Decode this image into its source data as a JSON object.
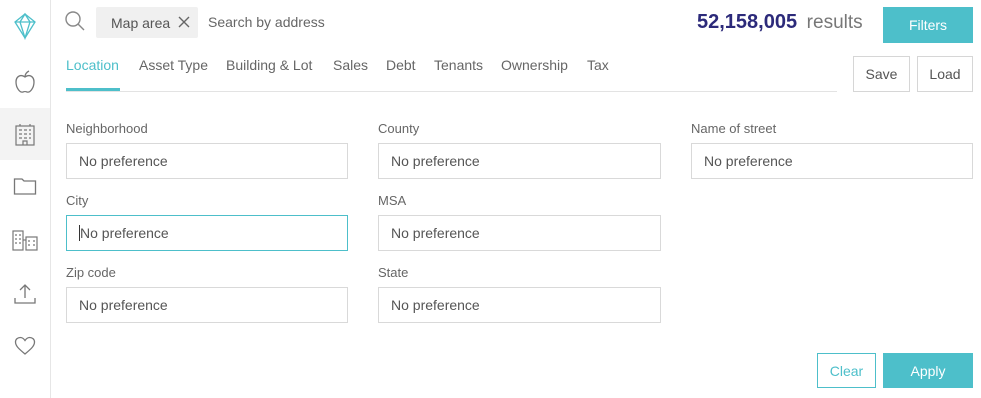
{
  "sidebar": {
    "items": [
      {
        "icon": "logo-icon"
      },
      {
        "icon": "apple-icon"
      },
      {
        "icon": "building-icon",
        "active": true
      },
      {
        "icon": "folder-icon"
      },
      {
        "icon": "buildings-compare-icon"
      },
      {
        "icon": "upload-icon"
      },
      {
        "icon": "heart-icon"
      }
    ]
  },
  "search": {
    "chip_label": "Map area",
    "placeholder": "Search by address"
  },
  "results": {
    "count": "52,158,005",
    "label": "results"
  },
  "buttons": {
    "filters": "Filters",
    "save": "Save",
    "load": "Load",
    "clear": "Clear",
    "apply": "Apply"
  },
  "tabs": [
    {
      "label": "Location",
      "active": true
    },
    {
      "label": "Asset Type"
    },
    {
      "label": "Building & Lot"
    },
    {
      "label": "Sales"
    },
    {
      "label": "Debt"
    },
    {
      "label": "Tenants"
    },
    {
      "label": "Ownership"
    },
    {
      "label": "Tax"
    }
  ],
  "fields": {
    "neighborhood": {
      "label": "Neighborhood",
      "value": "No preference"
    },
    "city": {
      "label": "City",
      "value": "No preference"
    },
    "zip": {
      "label": "Zip code",
      "value": "No preference"
    },
    "county": {
      "label": "County",
      "value": "No preference"
    },
    "msa": {
      "label": "MSA",
      "value": "No preference"
    },
    "state": {
      "label": "State",
      "value": "No preference"
    },
    "street": {
      "label": "Name of street",
      "value": "No preference"
    }
  },
  "colors": {
    "accent": "#4dbfca",
    "count": "#2c2a7a"
  }
}
